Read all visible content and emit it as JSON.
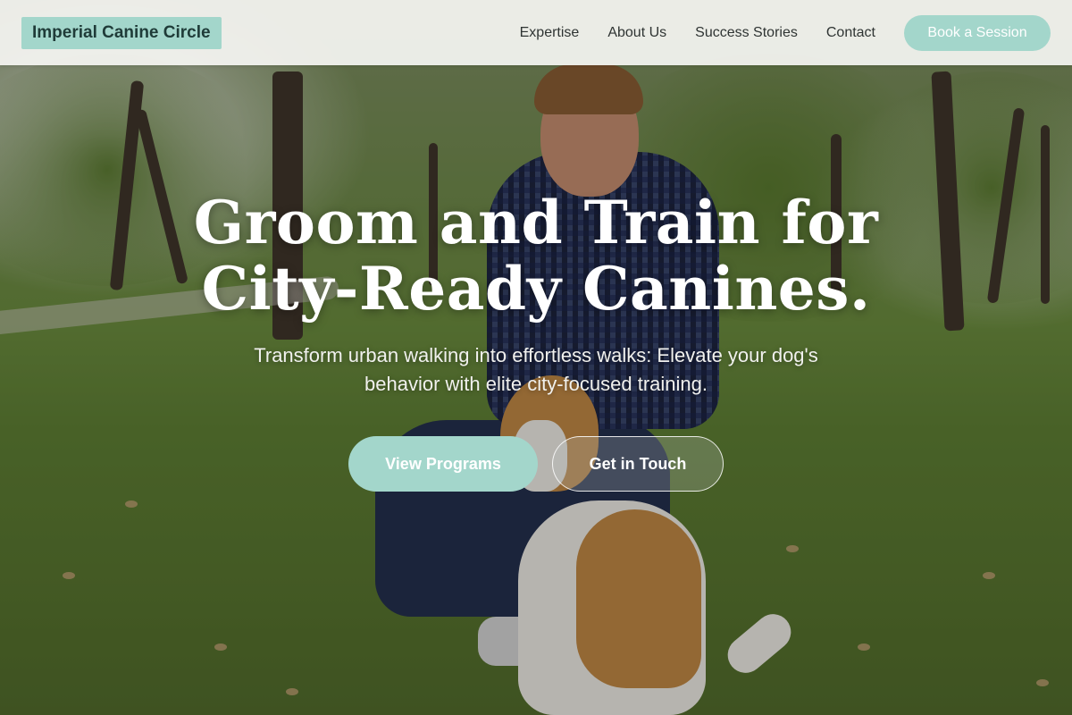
{
  "header": {
    "brand": "Imperial Canine Circle",
    "nav": [
      "Expertise",
      "About Us",
      "Success Stories",
      "Contact"
    ],
    "cta_label": "Book a Session"
  },
  "hero": {
    "headline_line1": "Groom and Train for",
    "headline_line2": "City-Ready Canines.",
    "subtitle": "Transform urban walking into effortless walks: Elevate your dog's behavior with elite city-focused training.",
    "primary_button": "View Programs",
    "secondary_button": "Get in Touch",
    "background_image": "person-training-dog-in-park"
  },
  "colors": {
    "accent": "#a3d6cb",
    "brand_text": "#1f3b38",
    "nav_text": "#2f3433",
    "header_bg": "#f5f5f2"
  }
}
